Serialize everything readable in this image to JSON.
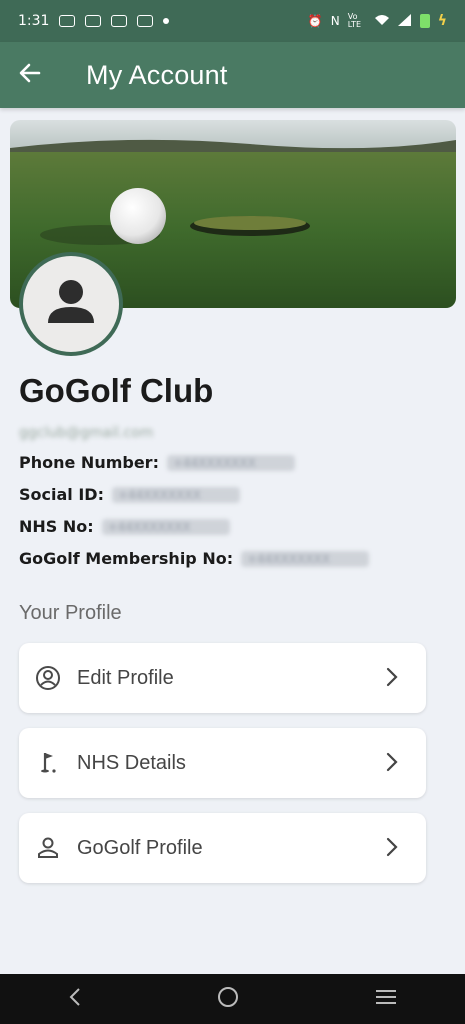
{
  "status_bar": {
    "time": "1:31",
    "network": "N",
    "volte": "Vo LTE"
  },
  "app_bar": {
    "title": "My Account"
  },
  "profile": {
    "name": "GoGolf Club",
    "email": "ggclub@gmail.com",
    "fields": [
      {
        "label": "Phone Number:",
        "value": "+44XXXXXXX"
      },
      {
        "label": "Social ID:",
        "value": "+44XXXXXXX"
      },
      {
        "label": "NHS No:",
        "value": "+44XXXXXXX"
      },
      {
        "label": "GoGolf Membership No:",
        "value": "+44XXXXXXX"
      }
    ]
  },
  "section": {
    "title": "Your Profile"
  },
  "menu": [
    {
      "label": "Edit Profile",
      "icon": "account-circle-icon"
    },
    {
      "label": "NHS Details",
      "icon": "golf-flag-icon"
    },
    {
      "label": "GoGolf Profile",
      "icon": "person-icon"
    }
  ],
  "colors": {
    "primary": "#4a7a63",
    "status": "#3f6a56",
    "background": "#eef1f6"
  }
}
